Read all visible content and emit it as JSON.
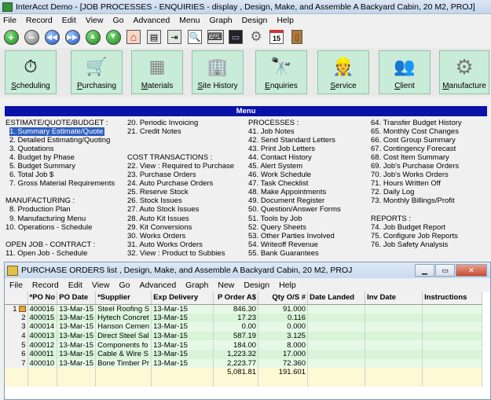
{
  "window": {
    "title": "InterAcct Demo - [JOB PROCESSES - ENQUIRIES - display , Design, Make, and Assemble A Backyard Cabin, 20 M2, PROJ]"
  },
  "main_menu": [
    "File",
    "Record",
    "Edit",
    "View",
    "Go",
    "Advanced",
    "Menu",
    "Graph",
    "Design",
    "Help"
  ],
  "toolbar": {
    "add": "+",
    "remove": "−",
    "first": "◀◀",
    "last": "▶▶",
    "up": "▲",
    "down": "▼",
    "home": "⌂",
    "print": "▤",
    "export": "⇥",
    "search": "🔍",
    "keyboard": "⌨",
    "monitor": "▭",
    "settings": "⚙",
    "calendar": "15",
    "exit": "▯"
  },
  "modules": [
    {
      "label": "Scheduling",
      "glyph": "⏱"
    },
    {
      "label": "Purchasing",
      "glyph": "🛒"
    },
    {
      "label": "Materials",
      "glyph": "▦"
    },
    {
      "label": "Site History",
      "glyph": "🏢"
    },
    {
      "label": "Enquiries",
      "glyph": "🔭"
    },
    {
      "label": "Service",
      "glyph": "👷"
    },
    {
      "label": "Client",
      "glyph": "👥"
    },
    {
      "label": "Manufacture",
      "glyph": "⚙"
    }
  ],
  "menu_panel": {
    "title": "Menu",
    "columns": [
      [
        "ESTIMATE/QUOTE/BUDGET :",
        "1. Summary Estimate/Quote",
        "2. Detailed Estimating/Quoting",
        "3. Quotations",
        "4. Budget by Phase",
        "5. Budget Summary",
        "6. Total Job $",
        "7. Gross Material Requirements",
        "",
        "MANUFACTURING :",
        "8. Production Plan",
        "9. Manufacturing Menu",
        "10. Operations - Schedule",
        "",
        "OPEN JOB - CONTRACT :",
        "11. Open Job - Schedule"
      ],
      [
        "20. Periodic Invoicing",
        "21. Credit Notes",
        "",
        "",
        "COST TRANSACTIONS :",
        "22. View : Required to Purchase",
        "23. Purchase Orders",
        "24. Auto Purchase Orders",
        "25. Reserve Stock",
        "26. Stock Issues",
        "27. Auto Stock Issues",
        "28. Auto Kit Issues",
        "29. Kit Conversions",
        "30. Works Orders",
        "31. Auto Works Orders",
        "32. View : Product to Subbies"
      ],
      [
        "PROCESSES :",
        "41. Job Notes",
        "42. Send Standard Letters",
        "43. Print Job Letters",
        "44. Contact History",
        "45. Alert System",
        "46. Work Schedule",
        "47. Task Checklist",
        "48. Make Appointments",
        "49. Document Register",
        "50. Question/Answer Forms",
        "51. Tools by Job",
        "52. Query Sheets",
        "53. Other Parties Involved",
        "54. Writeoff Revenue",
        "55. Bank Guarantees"
      ],
      [
        "64. Transfer Budget History",
        "65. Monthly Cost Changes",
        "66. Cost Group Summary",
        "67. Contingency Forecast",
        "68. Cost Item Summary",
        "69. Job's Purchase Orders",
        "70. Job's Works Orders",
        "71. Hours Written Off",
        "72. Daily Log",
        "73. Monthly Billings/Profit",
        "",
        "REPORTS :",
        "74. Job Budget Report",
        "75. Configure Job Reports",
        "76. Job Safety Analysis",
        ""
      ]
    ]
  },
  "child_window": {
    "title": "PURCHASE ORDERS list , Design, Make, and Assemble A Backyard Cabin, 20 M2, PROJ",
    "menu": [
      "File",
      "Record",
      "Edit",
      "View",
      "Go",
      "Advanced",
      "Graph",
      "New",
      "Design",
      "Help"
    ],
    "columns": [
      "",
      "*PO No",
      "PO Date",
      "*Supplier",
      "Exp Delivery",
      "P Order A$",
      "Qty O/S #",
      "Date Landed",
      "Inv Date",
      "Instructions"
    ],
    "rows": [
      [
        "1",
        "400016",
        "13-Mar-15",
        "Steel Roofing S",
        "13-Mar-15",
        "846.30",
        "91.000",
        "",
        "",
        ""
      ],
      [
        "2",
        "400015",
        "13-Mar-15",
        "Hytech Concret",
        "13-Mar-15",
        "17.23",
        "0.116",
        "",
        "",
        ""
      ],
      [
        "3",
        "400014",
        "13-Mar-15",
        "Hanson Cemen",
        "13-Mar-15",
        "0.00",
        "0.000",
        "",
        "",
        ""
      ],
      [
        "4",
        "400013",
        "13-Mar-15",
        "Direct Steel Sal",
        "13-Mar-15",
        "587.19",
        "3.125",
        "",
        "",
        ""
      ],
      [
        "5",
        "400012",
        "13-Mar-15",
        "Components fo",
        "13-Mar-15",
        "184.00",
        "8.000",
        "",
        "",
        ""
      ],
      [
        "6",
        "400011",
        "13-Mar-15",
        "Cable & Wire S",
        "13-Mar-15",
        "1,223.32",
        "17.000",
        "",
        "",
        ""
      ],
      [
        "7",
        "400010",
        "13-Mar-15",
        "Bone Timber Pr",
        "13-Mar-15",
        "2,223.77",
        "72.360",
        "",
        "",
        ""
      ]
    ],
    "totals": {
      "p_order": "5,081.81",
      "qty_os": "191.601"
    }
  }
}
